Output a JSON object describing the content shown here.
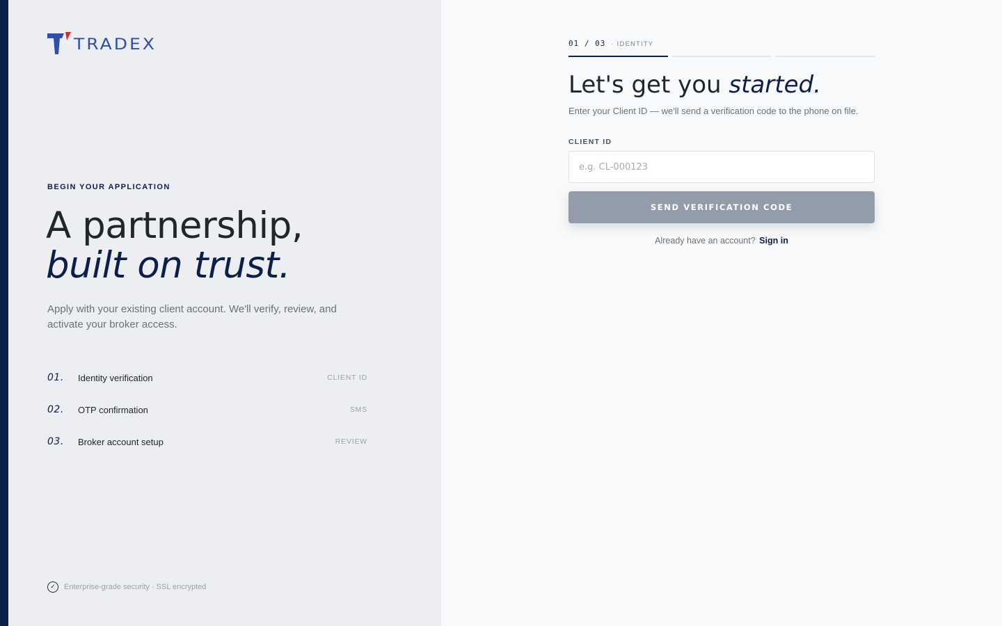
{
  "brand": {
    "name": "TRADEX",
    "logo_icon": "tradex-t-logo-icon",
    "colors": {
      "navy": "#0c1f4b",
      "blue": "#2f4fa8",
      "red": "#e0272e"
    }
  },
  "left": {
    "eyebrow": "BEGIN YOUR APPLICATION",
    "headline_line1": "A partnership,",
    "headline_line2": "built on trust.",
    "lead": "Apply with your existing client account. We'll verify, review, and activate your broker access.",
    "steps": [
      {
        "num": "01.",
        "label": "Identity verification",
        "tag": "CLIENT ID"
      },
      {
        "num": "02.",
        "label": "OTP confirmation",
        "tag": "SMS"
      },
      {
        "num": "03.",
        "label": "Broker account setup",
        "tag": "REVIEW"
      }
    ],
    "security_text": "Enterprise-grade security · SSL encrypted"
  },
  "form": {
    "step_count": "01 / 03",
    "step_name": "· IDENTITY",
    "progress_current": 1,
    "progress_total": 3,
    "title_plain": "Let's get you ",
    "title_em": "started.",
    "subtitle": "Enter your Client ID — we'll send a verification code to the phone on file.",
    "client_id_label": "CLIENT ID",
    "client_id_value": "",
    "client_id_placeholder": "e.g. CL-000123",
    "submit_label": "SEND VERIFICATION CODE",
    "signin_prompt": "Already have an account?",
    "signin_link": "Sign in"
  }
}
